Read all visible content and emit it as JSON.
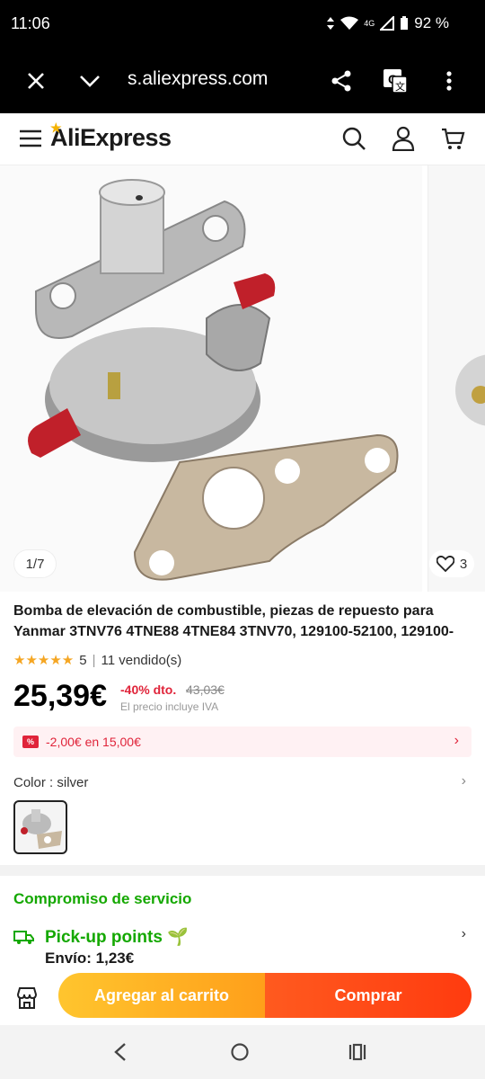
{
  "status_bar": {
    "time": "11:06",
    "network": "4G",
    "battery": "92 %"
  },
  "browser": {
    "url": "s.aliexpress.com",
    "icons": [
      "close-icon",
      "chevron-down-icon",
      "share-icon",
      "translate-icon",
      "more-vert-icon"
    ]
  },
  "header": {
    "logo": "AliExpress",
    "icons": [
      "menu-icon",
      "search-icon",
      "user-icon",
      "cart-icon"
    ]
  },
  "gallery": {
    "counter": "1/7",
    "wishlist_count": "3"
  },
  "product": {
    "title": "Bomba de elevación de combustible, piezas de repuesto para Yanmar 3TNV76 4TNE88 4TNE84 3TNV70, 129100-52100, 129100-",
    "rating": "5",
    "sold": "11 vendido(s)",
    "price": "25,39€",
    "discount": "-40% dto.",
    "old_price": "43,03€",
    "vat_note": "El precio incluye IVA",
    "coupon": "-2,00€ en 15,00€",
    "color_label": "Color",
    "color_value": "silver"
  },
  "service": {
    "title": "Compromiso de servicio",
    "pickup_title": "Pick-up points",
    "shipping": "Envío: 1,23€"
  },
  "actions": {
    "add_to_cart": "Agregar al carrito",
    "buy": "Comprar"
  },
  "colors": {
    "accent_red": "#e0243a",
    "green": "#14a800",
    "cart_orange": "#ffb020",
    "buy_red": "#ff4a14"
  }
}
